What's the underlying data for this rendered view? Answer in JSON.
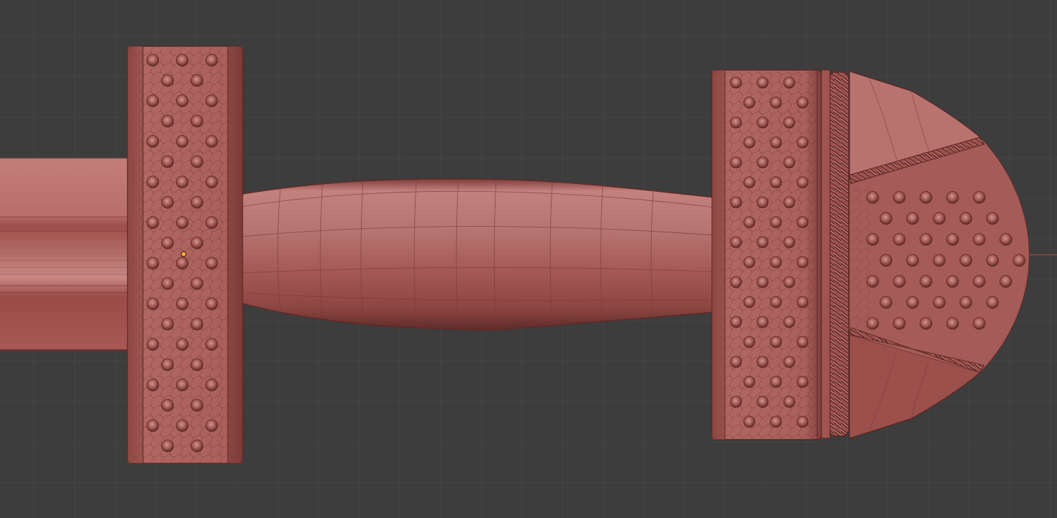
{
  "viewport": {
    "background": "#3d3d3d",
    "grid_color": "#4a4a4a",
    "axis_color": "#b34a52"
  },
  "model": {
    "name": "sword-hilt",
    "base_color": "#a85a55",
    "highlight_color": "#c98682",
    "shadow_color": "#6e3330",
    "wire_color": "#5a2624",
    "parts": [
      "blade",
      "crossguard",
      "grip",
      "pommel-guard",
      "pommel-cap"
    ]
  },
  "origin_marker_color": "#ffaa33"
}
